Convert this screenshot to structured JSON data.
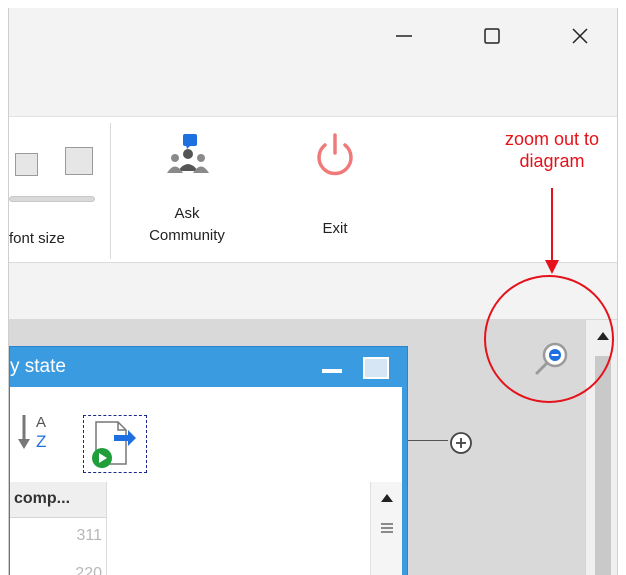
{
  "ribbon": {
    "font_size_label": "font size",
    "ask_community_label": "Ask Community",
    "exit_label": "Exit"
  },
  "annotation": {
    "text": "zoom out to diagram",
    "color": "#e5121b"
  },
  "panel": {
    "title": "y state",
    "column_header": "comp...",
    "rows": [
      "311",
      "220"
    ],
    "accent": "#3b9be0"
  },
  "icons": {
    "minimize": "minimize-icon",
    "maximize": "maximize-icon",
    "close": "close-icon",
    "ask_community": "community-icon",
    "exit": "power-icon",
    "zoom_out": "zoom-out-icon",
    "expand": "plus-circle-icon",
    "sort": "sort-az-icon",
    "export": "export-icon"
  }
}
